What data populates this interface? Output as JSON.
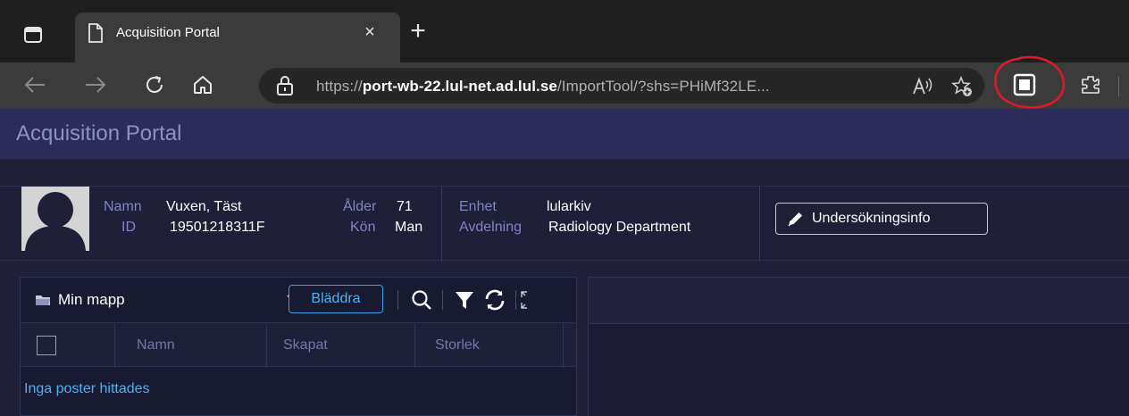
{
  "browser": {
    "tab_title": "Acquisition Portal",
    "tab_close": "×",
    "new_tab": "+",
    "url_scheme": "https://",
    "url_host": "port-wb-22.lul-net.ad.lul.se",
    "url_path": "/ImportTool/?shs=PHiMf32LE...",
    "icons": [
      "tab-actions-icon",
      "page-icon",
      "back-icon",
      "forward-icon",
      "refresh-icon",
      "home-icon",
      "lock-icon",
      "read-aloud-icon",
      "favorites-add-icon",
      "screen-icon",
      "extensions-icon"
    ]
  },
  "portal": {
    "title": "Acquisition Portal"
  },
  "patient": {
    "name_label": "Namn",
    "name_value": "Vuxen, Täst",
    "id_label": "ID",
    "id_value": "19501218311F",
    "age_label": "Ålder",
    "age_value": "71",
    "sex_label": "Kön",
    "sex_value": "Man",
    "unit_label": "Enhet",
    "unit_value": "lularkiv",
    "dept_label": "Avdelning",
    "dept_value": "Radiology Department",
    "info_button": "Undersökningsinfo"
  },
  "file_panel": {
    "folder": "Min mapp",
    "browse_button": "Bläddra",
    "columns": [
      "Namn",
      "Skapat",
      "Storlek"
    ],
    "empty_message": "Inga poster hittades"
  },
  "colors": {
    "accent": "#4db2f5",
    "portal_header": "#2c2c5a",
    "label": "#7f85c8",
    "annotation": "#e0192a"
  }
}
